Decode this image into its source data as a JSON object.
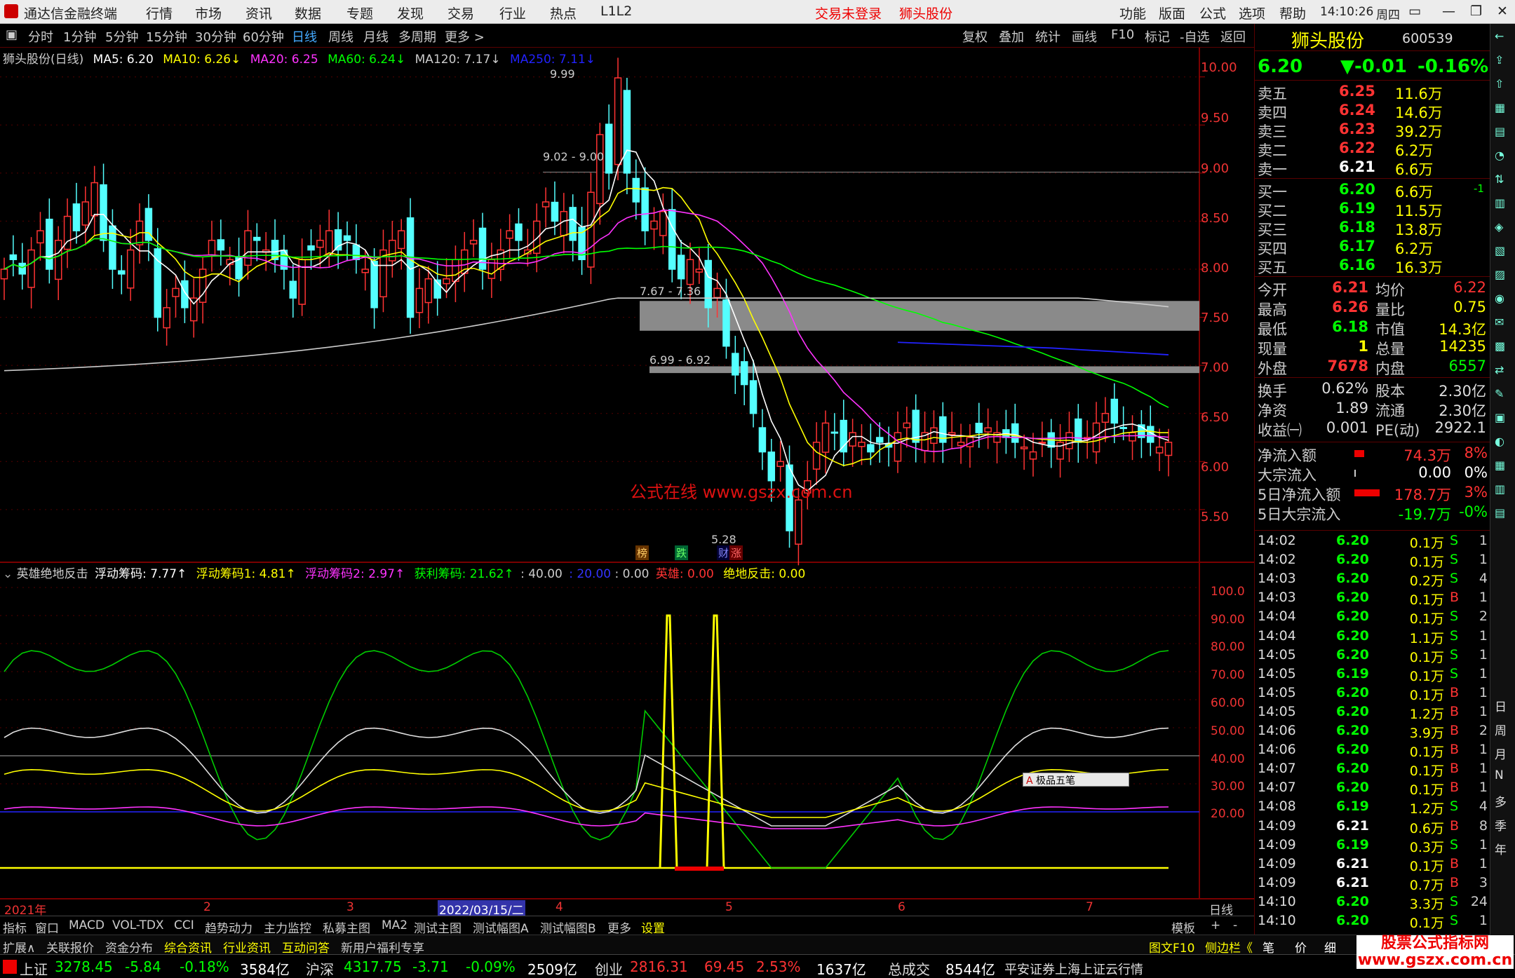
{
  "app": {
    "title": "通达信金融终端",
    "trade_status": "交易未登录",
    "active_stock": "狮头股份",
    "clock": "14:10:26",
    "weekday": "周四",
    "menu_left": [
      "行情",
      "市场",
      "资讯",
      "数据",
      "专题",
      "发现",
      "交易",
      "行业",
      "热点",
      "L1L2"
    ],
    "menu_right": [
      "功能",
      "版面",
      "公式",
      "选项",
      "帮助"
    ]
  },
  "toolbar": {
    "periods": [
      "分时",
      "1分钟",
      "5分钟",
      "15分钟",
      "30分钟",
      "60分钟",
      "日线",
      "周线",
      "月线",
      "多周期",
      "更多 >"
    ],
    "active_period": "日线",
    "tools": [
      "复权",
      "叠加",
      "统计",
      "画线",
      "F10",
      "标记",
      "-自选",
      "返回"
    ]
  },
  "main_chart": {
    "legend": {
      "name": "狮头股份(日线)",
      "ma5": "MA5: 6.20",
      "ma10": "MA10: 6.26↓",
      "ma20": "MA20: 6.25",
      "ma60": "MA60: 6.24↓",
      "ma120": "MA120: 7.17↓",
      "ma250": "MA250: 7.11↓"
    },
    "price_axis": [
      "10.00",
      "9.50",
      "9.00",
      "8.50",
      "8.00",
      "7.50",
      "7.00",
      "6.50",
      "6.00",
      "5.50"
    ],
    "annotations": {
      "high": "9.99",
      "a1": "9.02 - 9.00",
      "a2": "7.67 - 7.36",
      "a3": "6.99 - 6.92",
      "low": "5.28"
    },
    "markers": [
      "榜",
      "跌",
      "财",
      "涨"
    ],
    "watermark": "公式在线 www.gszx.com.cn"
  },
  "indicator": {
    "legend": {
      "name": "英雄绝地反击",
      "l1": "浮动筹码: 7.77↑",
      "l2": "浮动筹码1: 4.81↑",
      "l3": "浮动筹码2: 2.97↑",
      "l4": "获利筹码: 21.62↑",
      "l5": ": 40.00",
      "l6": ": 20.00",
      "l7": ": 0.00",
      "l8": "英雄: 0.00",
      "l9": "绝地反击: 0.00"
    },
    "axis": [
      "100.0",
      "90.00",
      "80.00",
      "70.00",
      "60.00",
      "50.00",
      "40.00",
      "30.00",
      "20.00"
    ],
    "ime_widget": "极品五笔"
  },
  "x_axis": {
    "labels": [
      "2021年",
      "2",
      "3",
      "2022/03/15/二",
      "4",
      "5",
      "6",
      "7"
    ],
    "period_label": "日线"
  },
  "chart_data": {
    "type": "line",
    "closes": [
      8.0,
      8.1,
      7.95,
      8.2,
      8.4,
      8.0,
      8.3,
      8.55,
      8.4,
      8.7,
      8.9,
      8.3,
      8.0,
      7.95,
      8.2,
      8.5,
      8.3,
      7.5,
      7.6,
      7.8,
      7.6,
      7.7,
      8.0,
      8.3,
      8.2,
      8.1,
      7.9,
      8.4,
      8.3,
      8.2,
      8.1,
      8.0,
      7.7,
      8.1,
      8.2,
      8.3,
      8.4,
      8.2,
      8.3,
      8.1,
      8.0,
      7.6,
      8.2,
      8.3,
      8.4,
      7.5,
      7.8,
      7.9,
      7.7,
      7.9,
      8.1,
      8.2,
      8.3,
      8.0,
      8.1,
      8.2,
      8.4,
      8.3,
      8.2,
      8.5,
      8.7,
      8.5,
      8.6,
      8.3,
      8.1,
      8.8,
      9.4,
      9.0,
      9.99,
      9.0,
      8.7,
      8.4,
      8.5,
      8.6,
      8.0,
      7.9,
      8.1,
      8.0,
      7.6,
      7.8,
      7.2,
      6.9,
      6.8,
      6.5,
      6.1,
      5.8,
      6.0,
      5.28,
      5.6,
      5.8,
      6.2,
      6.4,
      6.3,
      6.1,
      6.3,
      6.2,
      6.1,
      6.2,
      6.15,
      6.3,
      6.4,
      6.2,
      6.3,
      6.35,
      6.2,
      6.3,
      6.2,
      6.25,
      6.3,
      6.35,
      6.3,
      6.25,
      6.2,
      6.15,
      6.1,
      6.2,
      6.15,
      6.2,
      6.3,
      6.2,
      6.25,
      6.4,
      6.5,
      6.4,
      6.35,
      6.3,
      6.25,
      6.2,
      6.15,
      6.2
    ],
    "ma_lines": [
      "MA5",
      "MA10",
      "MA20",
      "MA60",
      "MA120",
      "MA250"
    ],
    "ylim": [
      5.2,
      10.1
    ]
  },
  "quote": {
    "name": "狮头股份",
    "code": "600539",
    "price": "6.20",
    "change": "▼-0.01",
    "pct": "-0.16%",
    "asks": [
      {
        "l": "卖五",
        "p": "6.25",
        "v": "11.6万"
      },
      {
        "l": "卖四",
        "p": "6.24",
        "v": "14.6万"
      },
      {
        "l": "卖三",
        "p": "6.23",
        "v": "39.2万"
      },
      {
        "l": "卖二",
        "p": "6.22",
        "v": "6.2万"
      },
      {
        "l": "卖一",
        "p": "6.21",
        "v": "6.6万"
      }
    ],
    "bids": [
      {
        "l": "买一",
        "p": "6.20",
        "v": "6.6万"
      },
      {
        "l": "买二",
        "p": "6.19",
        "v": "11.5万"
      },
      {
        "l": "买三",
        "p": "6.18",
        "v": "13.8万"
      },
      {
        "l": "买四",
        "p": "6.17",
        "v": "6.2万"
      },
      {
        "l": "买五",
        "p": "6.16",
        "v": "16.3万"
      }
    ],
    "bid1_delta": "-1",
    "stats": [
      {
        "k": "今开",
        "v": "6.21",
        "k2": "均价",
        "v2": "6.22"
      },
      {
        "k": "最高",
        "v": "6.26",
        "k2": "量比",
        "v2": "0.75"
      },
      {
        "k": "最低",
        "v": "6.18",
        "k2": "市值",
        "v2": "14.3亿"
      },
      {
        "k": "现量",
        "v": "1",
        "k2": "总量",
        "v2": "14235"
      },
      {
        "k": "外盘",
        "v": "7678",
        "k2": "内盘",
        "v2": "6557"
      }
    ],
    "stats2": [
      {
        "k": "换手",
        "v": "0.62%",
        "k2": "股本",
        "v2": "2.30亿"
      },
      {
        "k": "净资",
        "v": "1.89",
        "k2": "流通",
        "v2": "2.30亿"
      },
      {
        "k": "收益㈠",
        "v": "0.001",
        "k2": "PE(动)",
        "v2": "2922.1"
      }
    ],
    "flows": [
      {
        "k": "净流入额",
        "v": "74.3万",
        "p": "8%"
      },
      {
        "k": "大宗流入",
        "v": "0.00",
        "p": "0%"
      },
      {
        "k": "5日净流入额",
        "v": "178.7万",
        "p": "3%"
      },
      {
        "k": "5日大宗流入",
        "v": "-19.7万",
        "p": "-0%"
      }
    ],
    "ticks": [
      {
        "t": "14:02",
        "p": "6.20",
        "v": "0.1万",
        "s": "S",
        "n": "1"
      },
      {
        "t": "14:02",
        "p": "6.20",
        "v": "0.1万",
        "s": "S",
        "n": "1"
      },
      {
        "t": "14:03",
        "p": "6.20",
        "v": "0.2万",
        "s": "S",
        "n": "4"
      },
      {
        "t": "14:03",
        "p": "6.20",
        "v": "0.1万",
        "s": "B",
        "n": "1"
      },
      {
        "t": "14:04",
        "p": "6.20",
        "v": "0.1万",
        "s": "S",
        "n": "2"
      },
      {
        "t": "14:04",
        "p": "6.20",
        "v": "1.1万",
        "s": "S",
        "n": "1"
      },
      {
        "t": "14:05",
        "p": "6.20",
        "v": "0.1万",
        "s": "S",
        "n": "1"
      },
      {
        "t": "14:05",
        "p": "6.19",
        "v": "0.1万",
        "s": "S",
        "n": "1"
      },
      {
        "t": "14:05",
        "p": "6.20",
        "v": "0.1万",
        "s": "B",
        "n": "1"
      },
      {
        "t": "14:05",
        "p": "6.20",
        "v": "1.2万",
        "s": "B",
        "n": "1"
      },
      {
        "t": "14:06",
        "p": "6.20",
        "v": "3.9万",
        "s": "B",
        "n": "2"
      },
      {
        "t": "14:06",
        "p": "6.20",
        "v": "0.1万",
        "s": "B",
        "n": "1"
      },
      {
        "t": "14:07",
        "p": "6.20",
        "v": "0.1万",
        "s": "B",
        "n": "1"
      },
      {
        "t": "14:07",
        "p": "6.20",
        "v": "0.1万",
        "s": "B",
        "n": "1"
      },
      {
        "t": "14:08",
        "p": "6.19",
        "v": "1.2万",
        "s": "S",
        "n": "4"
      },
      {
        "t": "14:09",
        "p": "6.21",
        "v": "0.6万",
        "s": "B",
        "n": "8"
      },
      {
        "t": "14:09",
        "p": "6.19",
        "v": "0.3万",
        "s": "S",
        "n": "1"
      },
      {
        "t": "14:09",
        "p": "6.21",
        "v": "0.1万",
        "s": "B",
        "n": "1"
      },
      {
        "t": "14:09",
        "p": "6.21",
        "v": "0.7万",
        "s": "B",
        "n": "3"
      },
      {
        "t": "14:10",
        "p": "6.20",
        "v": "3.3万",
        "s": "S",
        "n": "24"
      },
      {
        "t": "14:10",
        "p": "6.20",
        "v": "0.1万",
        "s": "S",
        "n": "1"
      }
    ]
  },
  "tabs": [
    "指标",
    "窗口",
    "MACD",
    "VOL-TDX",
    "CCI",
    "趋势动力",
    "主力监控",
    "私募主图",
    "MA2",
    "测试主图",
    "测试幅图A",
    "测试幅图B",
    "更多",
    "设置"
  ],
  "tabs_right": [
    "模板",
    "+",
    "-"
  ],
  "bottom_tabs": [
    "扩展∧",
    "关联报价",
    "资金分布",
    "综合资讯",
    "行业资讯",
    "互动问答",
    "新用户福利专享"
  ],
  "bottom_right": [
    "图文F10",
    "侧边栏《",
    "笔",
    "价",
    "细"
  ],
  "indices": [
    {
      "n": "上证",
      "v": "3278.45",
      "c": "-5.84",
      "p": "-0.18%",
      "a": "3584亿"
    },
    {
      "n": "沪深",
      "v": "4317.75",
      "c": "-3.71",
      "p": "-0.09%",
      "a": "2509亿"
    },
    {
      "n": "创业",
      "v": "2816.31",
      "c": "69.45",
      "p": "2.53%",
      "a": "1637亿"
    }
  ],
  "total": {
    "k": "总成交",
    "v": "8544亿"
  },
  "broker": "平安证券上海上证云行情",
  "logo": "股票公式指标网 www.gszx.com.cn",
  "side_labels": [
    "日",
    "周",
    "月",
    "N",
    "多",
    "季",
    "年"
  ]
}
